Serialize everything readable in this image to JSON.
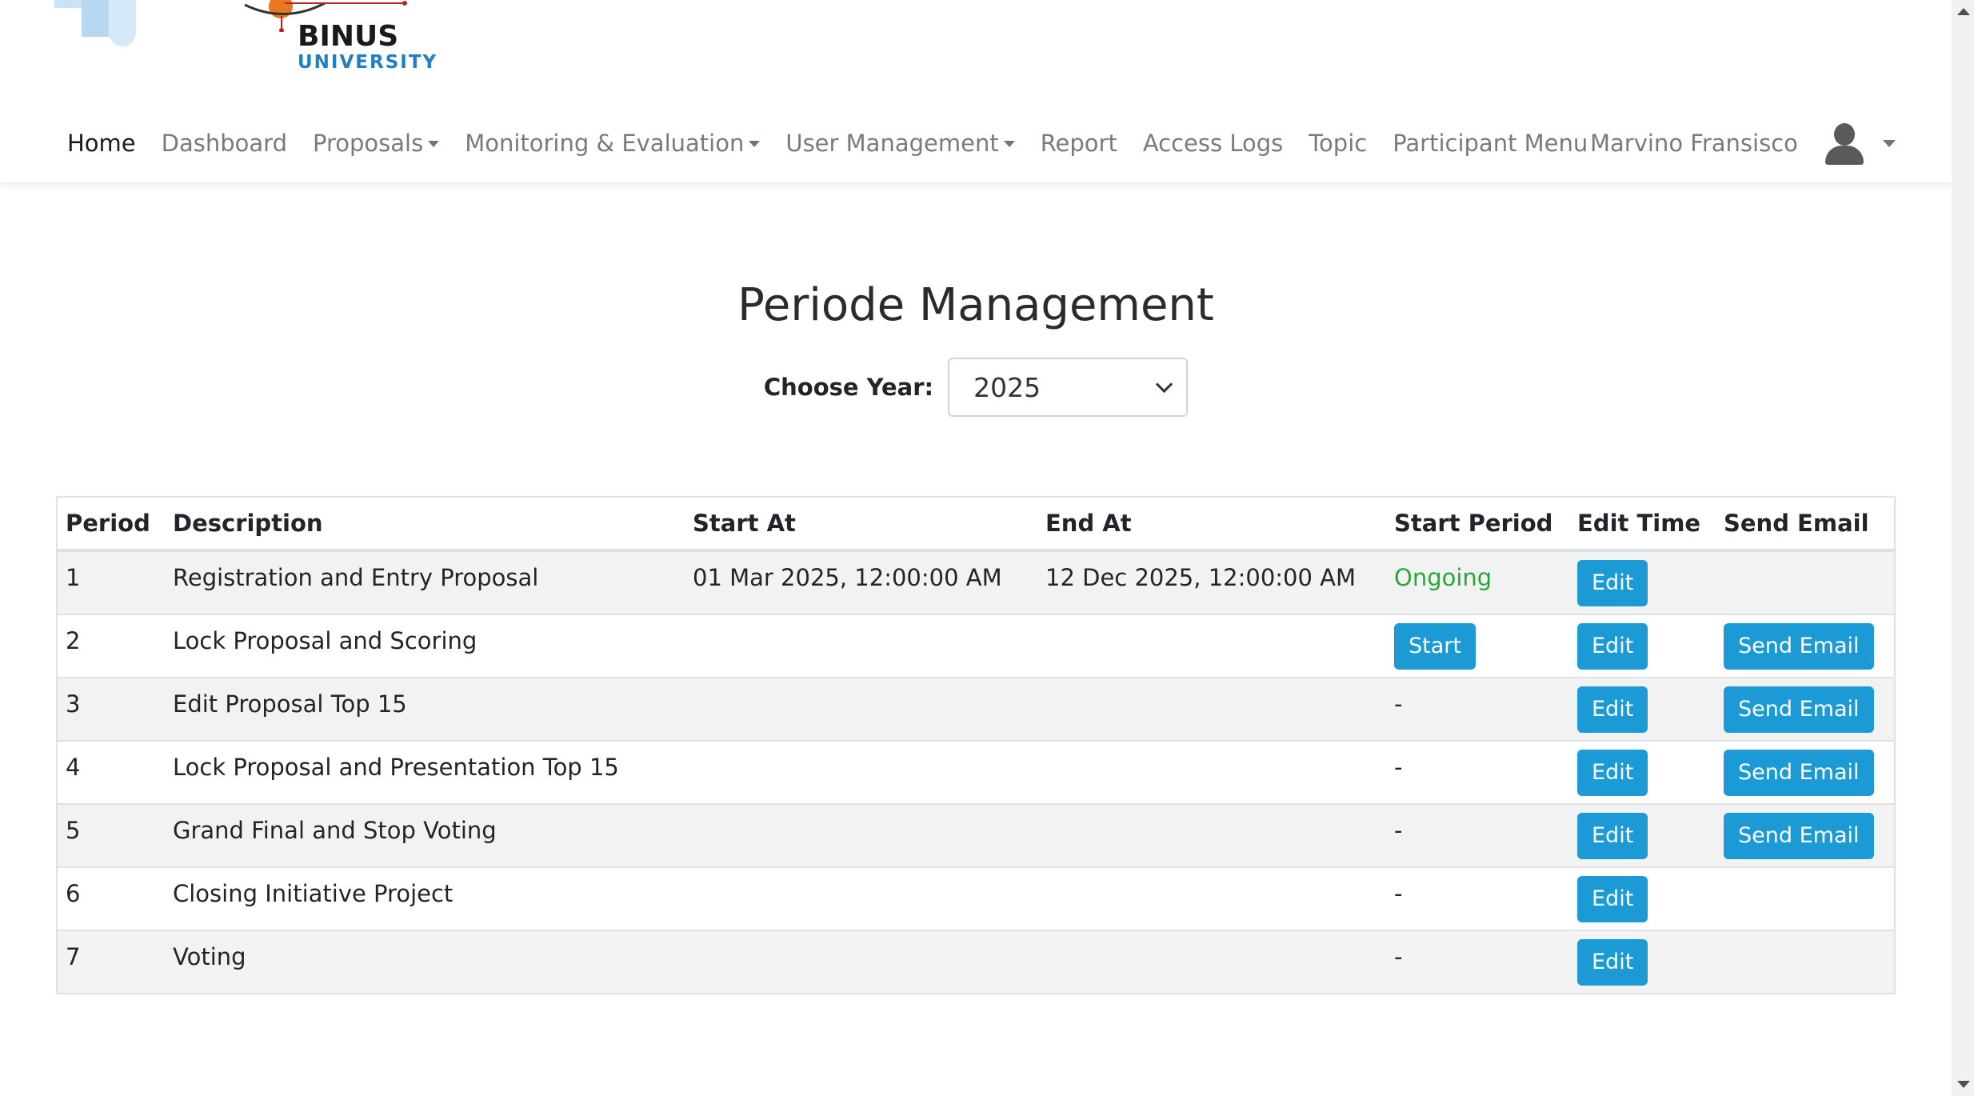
{
  "logo": {
    "main": "BINUS",
    "sub": "UNIVERSITY"
  },
  "nav": {
    "items": [
      {
        "label": "Home"
      },
      {
        "label": "Dashboard"
      },
      {
        "label": "Proposals"
      },
      {
        "label": "Monitoring & Evaluation"
      },
      {
        "label": "User Management"
      },
      {
        "label": "Report"
      },
      {
        "label": "Access Logs"
      },
      {
        "label": "Topic"
      },
      {
        "label": "Participant Menu"
      }
    ],
    "active": "Home"
  },
  "user": {
    "name": "Marvino Fransisco",
    "avatar_icon": "user-silhouette-icon"
  },
  "page": {
    "title": "Periode Management",
    "year_label": "Choose Year:",
    "year_value": "2025"
  },
  "table": {
    "headers": [
      "Period",
      "Description",
      "Start At",
      "End At",
      "Start Period",
      "Edit Time",
      "Send Email"
    ],
    "rows": [
      {
        "period": "1",
        "description": "Registration and Entry Proposal",
        "start_at": "01 Mar 2025, 12:00:00 AM",
        "end_at": "12 Dec 2025, 12:00:00 AM",
        "start_period": "Ongoing",
        "edit_label": "Edit",
        "send_email": ""
      },
      {
        "period": "2",
        "description": "Lock Proposal and Scoring",
        "start_at": "",
        "end_at": "",
        "start_period": "Start",
        "edit_label": "Edit",
        "send_email": "Send Email"
      },
      {
        "period": "3",
        "description": "Edit Proposal Top 15",
        "start_at": "",
        "end_at": "",
        "start_period": "-",
        "edit_label": "Edit",
        "send_email": "Send Email"
      },
      {
        "period": "4",
        "description": "Lock Proposal and Presentation Top 15",
        "start_at": "",
        "end_at": "",
        "start_period": "-",
        "edit_label": "Edit",
        "send_email": "Send Email"
      },
      {
        "period": "5",
        "description": "Grand Final and Stop Voting",
        "start_at": "",
        "end_at": "",
        "start_period": "-",
        "edit_label": "Edit",
        "send_email": "Send Email"
      },
      {
        "period": "6",
        "description": "Closing Initiative Project",
        "start_at": "",
        "end_at": "",
        "start_period": "-",
        "edit_label": "Edit",
        "send_email": ""
      },
      {
        "period": "7",
        "description": "Voting",
        "start_at": "",
        "end_at": "",
        "start_period": "-",
        "edit_label": "Edit",
        "send_email": ""
      }
    ]
  },
  "colors": {
    "primary_button": "#1b9ad6",
    "ongoing_status": "#2aa837",
    "brand_blue": "#1f7fc2",
    "brand_orange": "#e87722"
  }
}
